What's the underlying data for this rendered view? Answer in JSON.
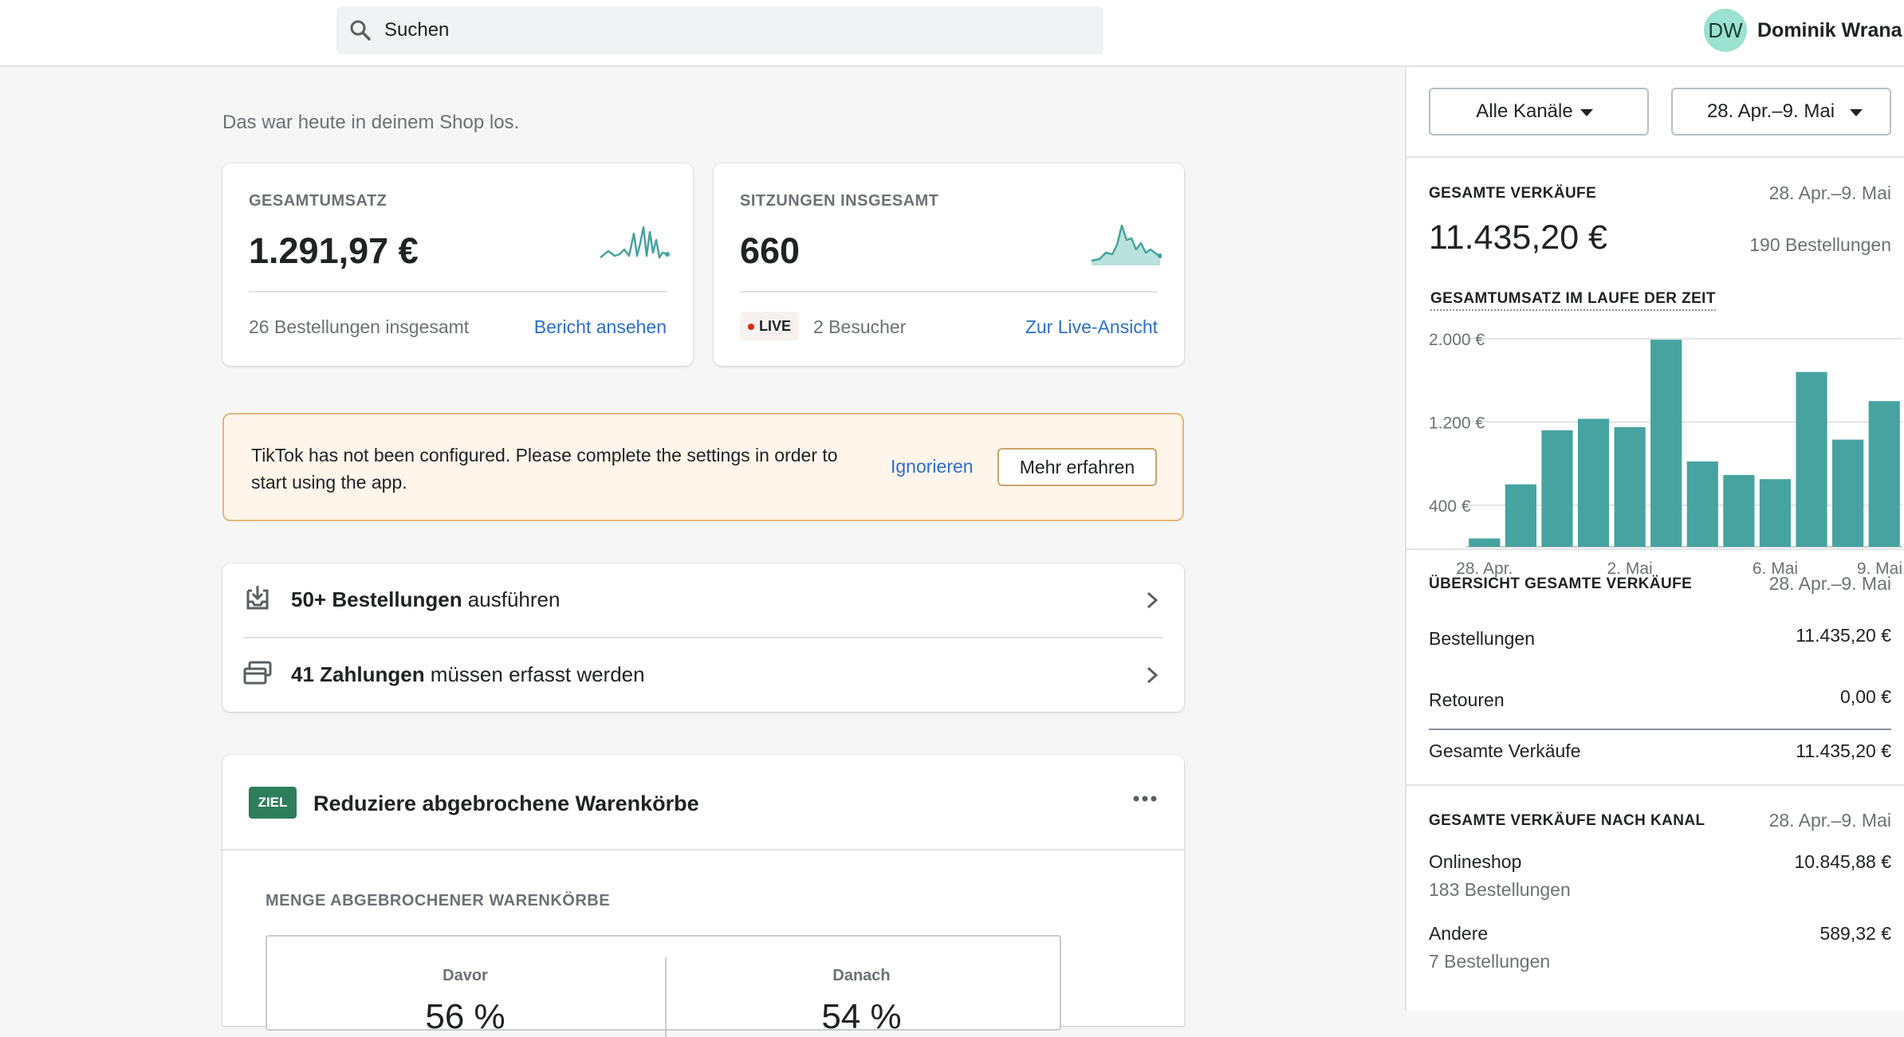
{
  "header": {
    "search_placeholder": "Suchen",
    "user_initials": "DW",
    "user_name": "Dominik Wrana"
  },
  "main": {
    "intro": "Das war heute in deinem Shop los.",
    "kpi_sales": {
      "label": "GESAMTUMSATZ",
      "value": "1.291,97 €",
      "footer": "26 Bestellungen insgesamt",
      "link": "Bericht ansehen"
    },
    "kpi_sessions": {
      "label": "SITZUNGEN INSGESAMT",
      "value": "660",
      "live_badge": "LIVE",
      "footer": "2 Besucher",
      "link": "Zur Live-Ansicht"
    },
    "banner": {
      "text": "TikTok has not been configured. Please complete the settings in order to start using the app.",
      "ignore": "Ignorieren",
      "learn_more": "Mehr erfahren"
    },
    "tasks": [
      {
        "bold": "50+ Bestellungen",
        "rest": " ausführen"
      },
      {
        "bold": "41 Zahlungen",
        "rest": " müssen erfasst werden"
      }
    ],
    "goal": {
      "badge": "ZIEL",
      "title": "Reduziere abgebrochene Warenkörbe",
      "subtitle": "MENGE ABGEBROCHENER WARENKÖRBE",
      "before_label": "Davor",
      "before_value": "56 %",
      "after_label": "Danach",
      "after_value": "54 %"
    }
  },
  "sidebar": {
    "channel_dropdown": "Alle Kanäle",
    "date_dropdown": "28. Apr.–9. Mai",
    "total_sales": {
      "title": "GESAMTE VERKÄUFE",
      "date": "28. Apr.–9. Mai",
      "value": "11.435,20 €",
      "orders": "190 Bestellungen",
      "chart_title": "GESAMTUMSATZ IM LAUFE DER ZEIT"
    },
    "overview": {
      "title": "ÜBERSICHT GESAMTE VERKÄUFE",
      "date": "28. Apr.–9. Mai",
      "rows": [
        {
          "label": "Bestellungen",
          "value": "11.435,20 €"
        },
        {
          "label": "Retouren",
          "value": "0,00 €"
        },
        {
          "label": "Gesamte Verkäufe",
          "value": "11.435,20 €"
        }
      ]
    },
    "by_channel": {
      "title": "GESAMTE VERKÄUFE NACH KANAL",
      "date": "28. Apr.–9. Mai",
      "rows": [
        {
          "label": "Onlineshop",
          "value": "10.845,88 €",
          "sub": "183 Bestellungen"
        },
        {
          "label": "Andere",
          "value": "589,32 €",
          "sub": "7 Bestellungen"
        }
      ]
    }
  },
  "colors": {
    "accent_teal": "#47a3a0",
    "link_blue": "#2c6ecb",
    "goal_green": "#2e7d5b",
    "banner_bg": "#fff5ea"
  },
  "chart_data": {
    "type": "bar",
    "title": "GESAMTUMSATZ IM LAUFE DER ZEIT",
    "categories": [
      "28. Apr.",
      "29. Apr.",
      "30. Apr.",
      "1. Mai",
      "2. Mai",
      "3. Mai",
      "4. Mai",
      "5. Mai",
      "6. Mai",
      "7. Mai",
      "8. Mai",
      "9. Mai"
    ],
    "x_tick_labels": [
      "28. Apr.",
      "2. Mai",
      "6. Mai",
      "9. Mai"
    ],
    "y_tick_labels": [
      "2.000 €",
      "1.200 €",
      "400 €"
    ],
    "y_ticks": [
      2000,
      1200,
      400
    ],
    "values": [
      80,
      600,
      1120,
      1230,
      1150,
      1990,
      820,
      690,
      650,
      1680,
      1030,
      1400
    ],
    "ylim": [
      0,
      2160
    ]
  }
}
